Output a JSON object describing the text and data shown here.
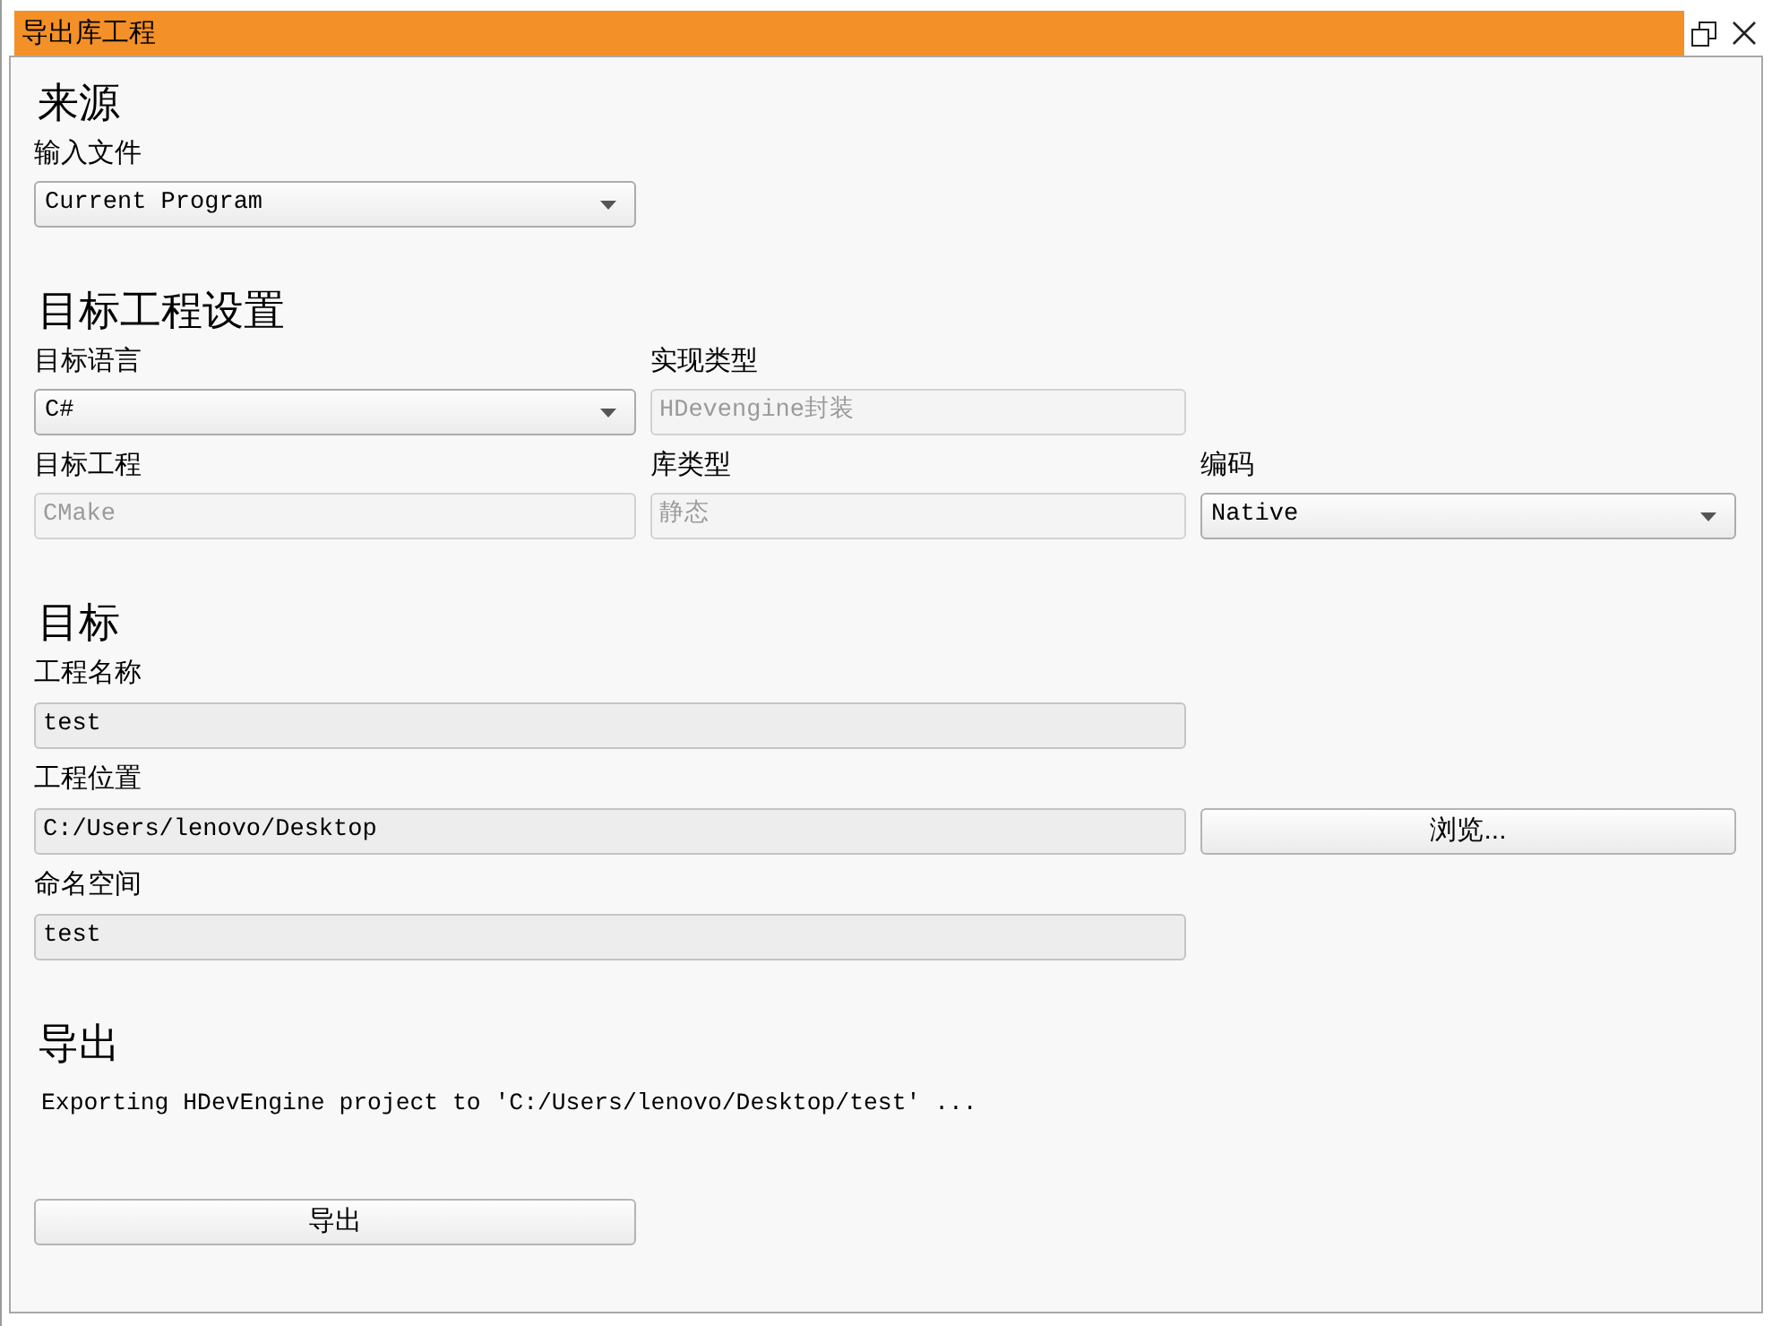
{
  "window": {
    "title": "导出库工程"
  },
  "sections": [
    {
      "kind": "grid",
      "heading": "来源",
      "rows": [
        [
          {
            "kind": "combo",
            "label": "输入文件",
            "value": "Current Program",
            "disabled": false
          }
        ]
      ]
    },
    {
      "kind": "grid",
      "heading": "目标工程设置",
      "rows": [
        [
          {
            "kind": "combo",
            "label": "目标语言",
            "value": "C#",
            "disabled": false
          },
          {
            "kind": "text",
            "label": "实现类型",
            "value": "HDevengine封装",
            "disabled": true
          }
        ],
        [
          {
            "kind": "text",
            "label": "目标工程",
            "value": "CMake",
            "disabled": true
          },
          {
            "kind": "text",
            "label": "库类型",
            "value": "静态",
            "disabled": true
          },
          {
            "kind": "combo",
            "label": "编码",
            "value": "Native",
            "disabled": false
          }
        ]
      ]
    },
    {
      "kind": "list",
      "heading": "目标",
      "rows": [
        [
          {
            "kind": "text",
            "label": "工程名称",
            "value": "test",
            "disabled": false
          }
        ],
        [
          {
            "kind": "text",
            "label": "工程位置",
            "value": "C:/Users/lenovo/Desktop",
            "disabled": false
          },
          {
            "kind": "button",
            "label": "浏览..."
          }
        ],
        [
          {
            "kind": "text",
            "label": "命名空间",
            "value": "test",
            "disabled": false
          }
        ]
      ]
    },
    {
      "kind": "output",
      "heading": "导出",
      "message": "Exporting HDevEngine project to 'C:/Users/lenovo/Desktop/test' ...",
      "button": "导出"
    }
  ]
}
